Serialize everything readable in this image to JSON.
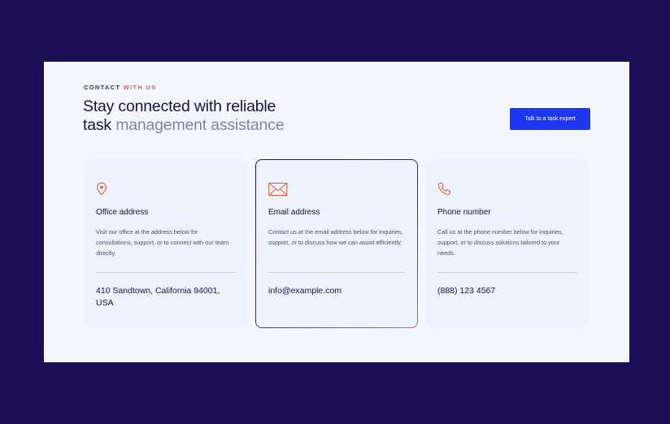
{
  "header": {
    "eyebrow_part1": "CONTACT",
    "eyebrow_part2": "WITH US",
    "headline_line1": "Stay connected with reliable",
    "headline_line2_strong": "task",
    "headline_line2_muted": "management assistance",
    "cta_label": "Talk to a task expert"
  },
  "cards": [
    {
      "icon": "location-pin-icon",
      "title": "Office address",
      "description": "Visit our office at the address below for consultations, support, or to connect with our team directly.",
      "value": "410 Sandtown, California 94001, USA"
    },
    {
      "icon": "envelope-icon",
      "title": "Email address",
      "description": "Contact us at the email address below for inquiries, support, or to discuss how we can assist efficiently.",
      "value": "info@example.com"
    },
    {
      "icon": "phone-icon",
      "title": "Phone number",
      "description": "Call us at the phone number below for inquiries, support, or to discuss solutions tailored to your needs.",
      "value": "(888) 123 4567"
    }
  ],
  "colors": {
    "background": "#1b0e55",
    "panel": "#f4f7ff",
    "card": "#eef2fd",
    "heading": "#141447",
    "muted": "#7a84a6",
    "accent": "#e0643d",
    "primary_button": "#1f36f0"
  }
}
